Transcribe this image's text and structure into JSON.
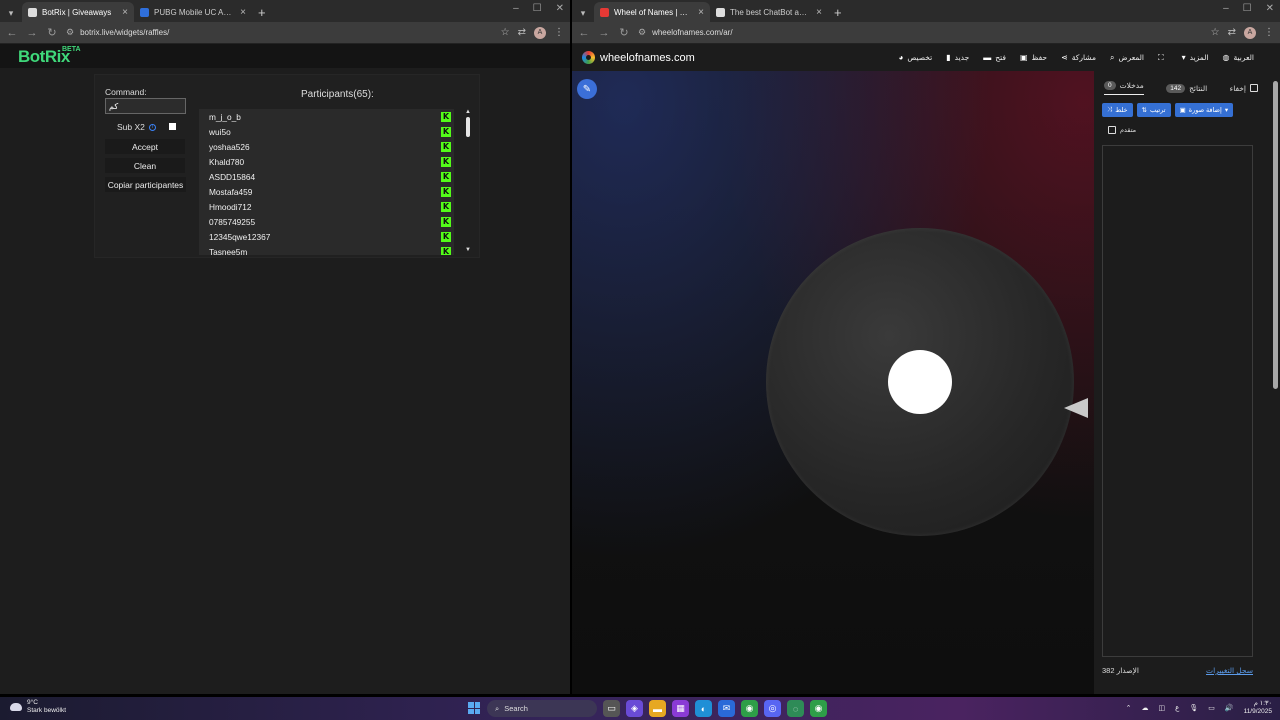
{
  "left_window": {
    "tabs": [
      {
        "title": "BotRix | Giveaways",
        "favicon_color": "#e5e5e5"
      },
      {
        "title": "PUBG Mobile UC Australia | 10%...",
        "favicon_color": "#2f6fdb"
      }
    ],
    "url": "botrix.live/widgets/raffles/",
    "profile_initial": "A",
    "page": {
      "logo": "BotRix",
      "beta": "BETA",
      "command_label": "Command:",
      "command_value": "كم",
      "sub_label": "Sub X2",
      "buttons": {
        "accept": "Accept",
        "clean": "Clean",
        "copy": "Copiar participantes"
      },
      "participants_title": "Participants(65):",
      "participants": [
        "m_j_o_b",
        "wui5o",
        "yoshaa526",
        "Khald780",
        "ASDD15864",
        "Mostafa459",
        "Hmoodi712",
        "0785749255",
        "12345qwe12367",
        "Tasnee5m"
      ],
      "platform_icon": "K"
    }
  },
  "right_window": {
    "tabs": [
      {
        "title": "Wheel of Names | اسم العشوائي",
        "favicon_color": "#e53935"
      },
      {
        "title": "The best ChatBot and Widgets",
        "favicon_color": "#e5e5e5"
      }
    ],
    "url": "wheelofnames.com/ar/",
    "profile_initial": "A",
    "page": {
      "site_name": "wheelofnames.com",
      "menu": [
        {
          "label": "تخصيص",
          "icon": "palette-icon",
          "glyph": "◕"
        },
        {
          "label": "جديد",
          "icon": "file-icon",
          "glyph": "▮"
        },
        {
          "label": "فتح",
          "icon": "folder-icon",
          "glyph": "▬"
        },
        {
          "label": "حفظ",
          "icon": "save-icon",
          "glyph": "▣"
        },
        {
          "label": "مشاركة",
          "icon": "share-icon",
          "glyph": "⋖"
        },
        {
          "label": "المعرض",
          "icon": "search-icon",
          "glyph": "⌕"
        },
        {
          "label": "",
          "icon": "fullscreen-icon",
          "glyph": "⛶"
        },
        {
          "label": "المزيد",
          "icon": "chevron-down-icon",
          "glyph": "▾"
        },
        {
          "label": "العربية",
          "icon": "globe-icon",
          "glyph": "◍"
        }
      ],
      "sidebar": {
        "hide_label": "إخفاء",
        "results_label": "النتائج",
        "results_count": "142",
        "entries_label": "مدخلات",
        "entries_count": "0",
        "shuffle": "خلط",
        "sort": "ترتيب",
        "add_image": "إضافة صورة",
        "advanced": "متقدم",
        "version": "الإصدار 382",
        "changelog": "سجل التغييرات"
      }
    }
  },
  "taskbar": {
    "weather_temp": "9°C",
    "weather_desc": "Stark bewölkt",
    "search": "Search",
    "time": "١:٣٠ م",
    "date": "11/9/2025",
    "lang": "ع"
  }
}
